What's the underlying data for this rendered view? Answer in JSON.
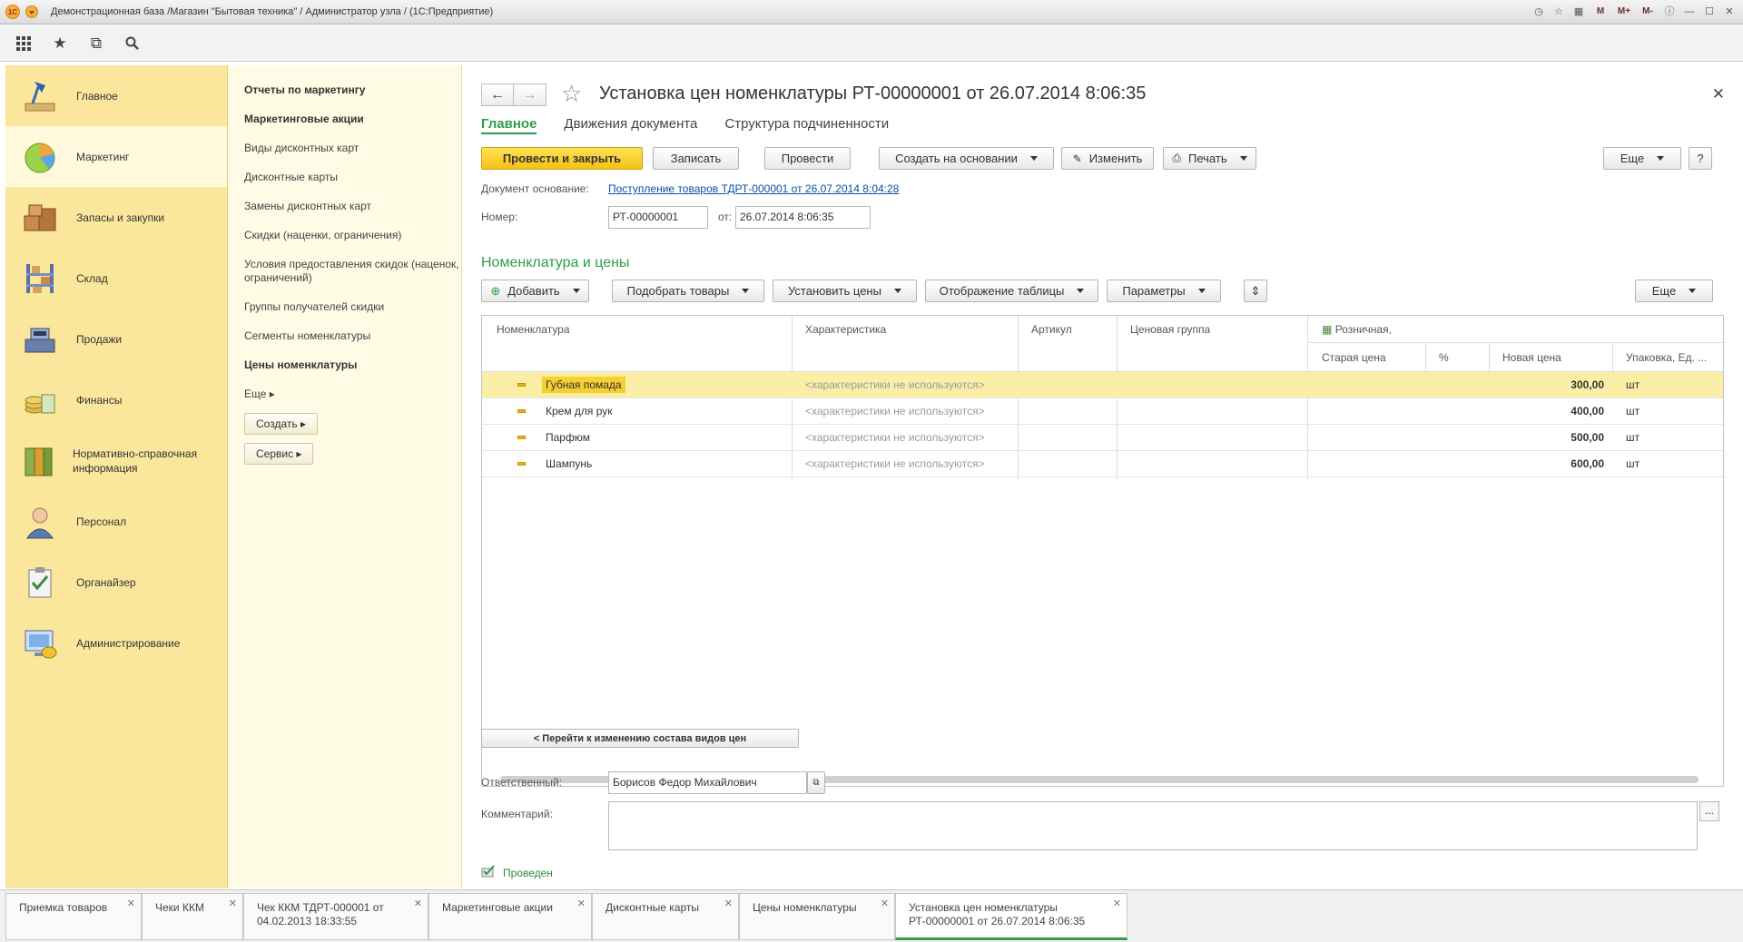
{
  "window": {
    "title": "Демонстрационная база /Магазин \"Бытовая техника\" / Администратор узла /  (1С:Предприятие)",
    "controls": [
      "M",
      "M+",
      "M-"
    ]
  },
  "sections": [
    {
      "label": "Главное",
      "icon": "desk-lamp-icon"
    },
    {
      "label": "Маркетинг",
      "icon": "pie-chart-icon"
    },
    {
      "label": "Запасы и закупки",
      "icon": "boxes-icon"
    },
    {
      "label": "Склад",
      "icon": "shelf-icon"
    },
    {
      "label": "Продажи",
      "icon": "cash-register-icon"
    },
    {
      "label": "Финансы",
      "icon": "coins-icon"
    },
    {
      "label": "Нормативно-справочная информация",
      "icon": "binders-icon"
    },
    {
      "label": "Персонал",
      "icon": "person-icon"
    },
    {
      "label": "Органайзер",
      "icon": "clipboard-icon"
    },
    {
      "label": "Администрирование",
      "icon": "computer-icon"
    }
  ],
  "commands": {
    "items": [
      {
        "label": "Отчеты по маркетингу",
        "bold": true
      },
      {
        "label": "Маркетинговые акции",
        "bold": true
      },
      {
        "label": "Виды дисконтных карт",
        "bold": false
      },
      {
        "label": "Дисконтные карты",
        "bold": false
      },
      {
        "label": "Замены дисконтных карт",
        "bold": false
      },
      {
        "label": "Скидки (наценки, ограничения)",
        "bold": false
      },
      {
        "label": "Условия предоставления скидок (наценок, ограничений)",
        "bold": false
      },
      {
        "label": "Группы получателей скидки",
        "bold": false
      },
      {
        "label": "Сегменты номенклатуры",
        "bold": false
      },
      {
        "label": "Цены номенклатуры",
        "bold": true
      }
    ],
    "more": "Еще",
    "create": "Создать",
    "service": "Сервис"
  },
  "form": {
    "title": "Установка цен номенклатуры РТ-00000001 от 26.07.2014 8:06:35",
    "tabs": [
      "Главное",
      "Движения документа",
      "Структура подчиненности"
    ],
    "buttons": {
      "post_close": "Провести и закрыть",
      "save": "Записать",
      "post": "Провести",
      "create_based": "Создать на основании",
      "edit": "Изменить",
      "print": "Печать",
      "more": "Еще",
      "help": "?"
    },
    "basis_label": "Документ основание:",
    "basis_link": "Поступление товаров ТДРТ-000001 от 26.07.2014 8:04:28",
    "number_label": "Номер:",
    "number_value": "РТ-00000001",
    "date_label": "от:",
    "date_value": "26.07.2014  8:06:35",
    "group_title": "Номенклатура и цены",
    "table_buttons": {
      "add": "Добавить",
      "pick": "Подобрать товары",
      "set_prices": "Установить цены",
      "display": "Отображение таблицы",
      "params": "Параметры",
      "more": "Еще"
    },
    "table": {
      "headers": {
        "nomenclature": "Номенклатура",
        "characteristic": "Характеристика",
        "article": "Артикул",
        "price_group": "Ценовая группа",
        "price_type": "Розничная,",
        "old_price": "Старая цена",
        "percent": "%",
        "new_price": "Новая цена",
        "packing": "Упаковка, Ед. ..."
      },
      "rows": [
        {
          "name": "Губная помада",
          "characteristic": "<характеристики не используются>",
          "new_price": "300,00",
          "unit": "шт"
        },
        {
          "name": "Крем для рук",
          "characteristic": "<характеристики не используются>",
          "new_price": "400,00",
          "unit": "шт"
        },
        {
          "name": "Парфюм",
          "characteristic": "<характеристики не используются>",
          "new_price": "500,00",
          "unit": "шт"
        },
        {
          "name": "Шампунь",
          "characteristic": "<характеристики не используются>",
          "new_price": "600,00",
          "unit": "шт"
        }
      ]
    },
    "goto_button": "< Перейти к изменению состава видов цен",
    "responsible_label": "Ответственный:",
    "responsible_value": "Борисов Федор Михайлович",
    "comment_label": "Комментарий:",
    "comment_dots": "...",
    "status": "Проведен"
  },
  "open_windows": [
    {
      "line1": "Приемка товаров",
      "line2": "",
      "active": false
    },
    {
      "line1": "Чеки ККМ",
      "line2": "",
      "active": false
    },
    {
      "line1": "Чек ККМ ТДРТ-000001  от",
      "line2": "04.02.2013 18:33:55",
      "active": false
    },
    {
      "line1": "Маркетинговые акции",
      "line2": "",
      "active": false
    },
    {
      "line1": "Дисконтные карты",
      "line2": "",
      "active": false
    },
    {
      "line1": "Цены номенклатуры",
      "line2": "",
      "active": false
    },
    {
      "line1": "Установка цен номенклатуры",
      "line2": "РТ-00000001 от 26.07.2014 8:06:35",
      "active": true
    }
  ],
  "colors": {
    "accent_green": "#2e9d4c",
    "primary_button": "#f4c214",
    "sections_bg": "#fbe79b",
    "selected_row": "#fbeea6",
    "link": "#0b4fa3"
  }
}
